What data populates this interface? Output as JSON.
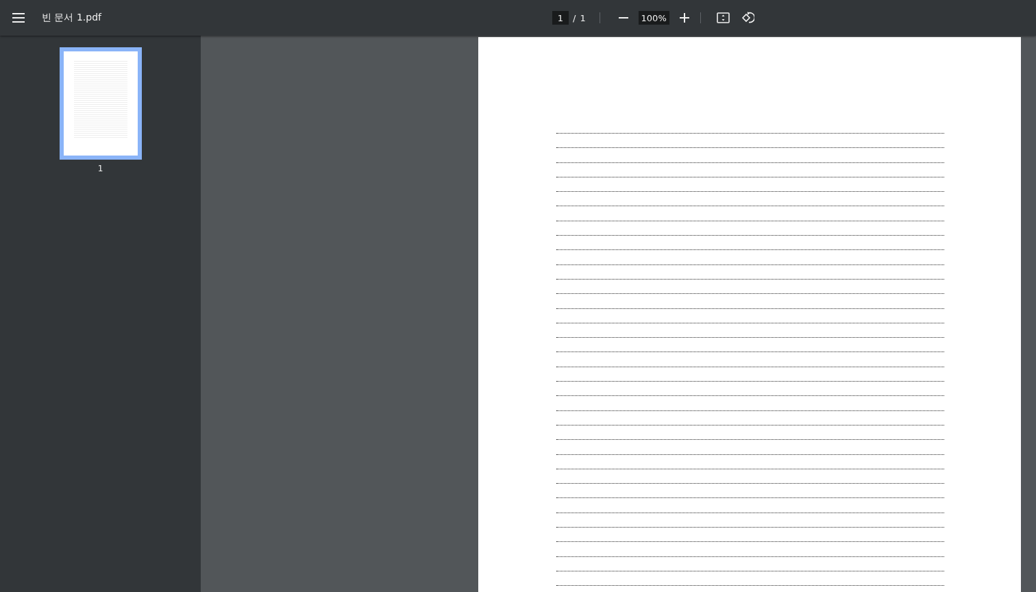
{
  "toolbar": {
    "title": "빈 문서 1.pdf",
    "page_field": {
      "value": "1"
    },
    "separator": "/",
    "page_count": "1",
    "zoom_field": {
      "value": "100%"
    }
  },
  "thumbnails": [
    {
      "label": "1",
      "selected": true
    }
  ]
}
